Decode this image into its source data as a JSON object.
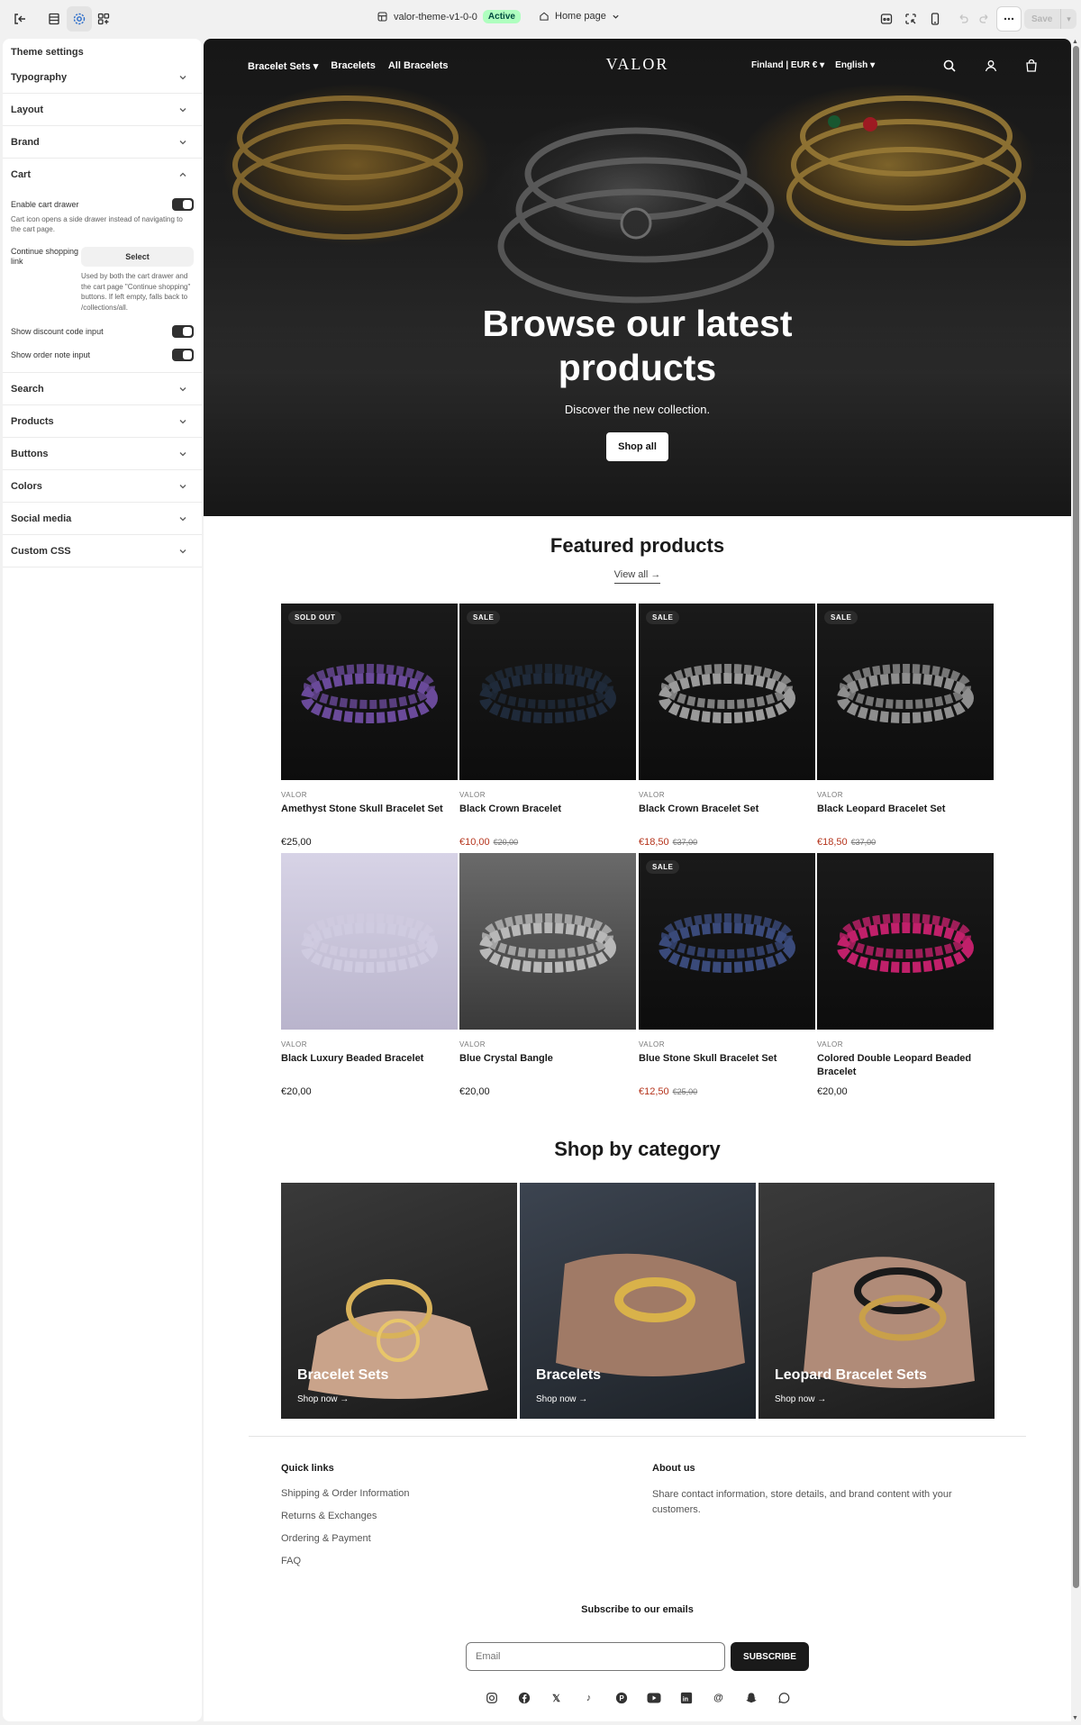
{
  "editor": {
    "theme_name": "valor-theme-v1-0-0",
    "theme_status": "Active",
    "page_selector": "Home page",
    "save_label": "Save"
  },
  "sidebar": {
    "title": "Theme settings",
    "sections": [
      {
        "label": "Typography"
      },
      {
        "label": "Layout"
      },
      {
        "label": "Brand"
      },
      {
        "label": "Cart"
      },
      {
        "label": "Search"
      },
      {
        "label": "Products"
      },
      {
        "label": "Buttons"
      },
      {
        "label": "Colors"
      },
      {
        "label": "Social media"
      },
      {
        "label": "Custom CSS"
      }
    ],
    "cart": {
      "enable_drawer_label": "Enable cart drawer",
      "enable_drawer_help": "Cart icon opens a side drawer instead of navigating to the cart page.",
      "continue_label": "Continue shopping link",
      "select_label": "Select",
      "continue_help": "Used by both the cart drawer and the cart page \"Continue shopping\" buttons. If left empty, falls back to /collections/all.",
      "discount_label": "Show discount code input",
      "order_note_label": "Show order note input"
    }
  },
  "store": {
    "logo": "VALOR",
    "nav": [
      "Bracelet Sets",
      "Bracelets",
      "All Bracelets"
    ],
    "locale": "Finland | EUR €",
    "language": "English",
    "hero": {
      "title": "Browse our latest products",
      "subtitle": "Discover the new collection.",
      "button": "Shop all"
    },
    "featured": {
      "title": "Featured products",
      "view_all": "View all →",
      "products": [
        {
          "vendor": "VALOR",
          "name": "Amethyst Stone Skull Bracelet Set",
          "price": "€25,00",
          "compare": "",
          "badge": "SOLD OUT",
          "color": "#6a4a9a"
        },
        {
          "vendor": "VALOR",
          "name": "Black Crown Bracelet",
          "price": "€10,00",
          "compare": "€20,00",
          "badge": "SALE",
          "color": "#1f2a3a"
        },
        {
          "vendor": "VALOR",
          "name": "Black Crown Bracelet Set",
          "price": "€18,50",
          "compare": "€37,00",
          "badge": "SALE",
          "color": "#9a9a9a"
        },
        {
          "vendor": "VALOR",
          "name": "Black Leopard Bracelet Set",
          "price": "€18,50",
          "compare": "€37,00",
          "badge": "SALE",
          "color": "#8e8e8e"
        },
        {
          "vendor": "VALOR",
          "name": "Black Luxury Beaded Bracelet",
          "price": "€20,00",
          "compare": "",
          "badge": "",
          "color": "#cfcbe0"
        },
        {
          "vendor": "VALOR",
          "name": "Blue Crystal Bangle",
          "price": "€20,00",
          "compare": "",
          "badge": "",
          "color": "#b8b8b8"
        },
        {
          "vendor": "VALOR",
          "name": "Blue Stone Skull Bracelet Set",
          "price": "€12,50",
          "compare": "€25,00",
          "badge": "SALE",
          "color": "#3a4a7a"
        },
        {
          "vendor": "VALOR",
          "name": "Colored Double Leopard Beaded Bracelet",
          "price": "€20,00",
          "compare": "",
          "badge": "",
          "color": "#c0206a"
        }
      ]
    },
    "categories": {
      "title": "Shop by category",
      "items": [
        {
          "label": "Bracelet Sets",
          "link": "Shop now →"
        },
        {
          "label": "Bracelets",
          "link": "Shop now →"
        },
        {
          "label": "Leopard Bracelet Sets",
          "link": "Shop now →"
        }
      ]
    },
    "footer": {
      "quick_links_title": "Quick links",
      "links": [
        "Shipping & Order Information",
        "Returns & Exchanges",
        "Ordering & Payment",
        "FAQ"
      ],
      "about_title": "About us",
      "about_text": "Share contact information, store details, and brand content with your customers.",
      "subscribe_title": "Subscribe to our emails",
      "email_placeholder": "Email",
      "subscribe_button": "SUBSCRIBE",
      "socials": [
        "instagram-icon",
        "facebook-icon",
        "x-icon",
        "tiktok-icon",
        "pinterest-icon",
        "youtube-icon",
        "linkedin-icon",
        "threads-icon",
        "snapchat-icon",
        "whatsapp-icon"
      ]
    }
  }
}
